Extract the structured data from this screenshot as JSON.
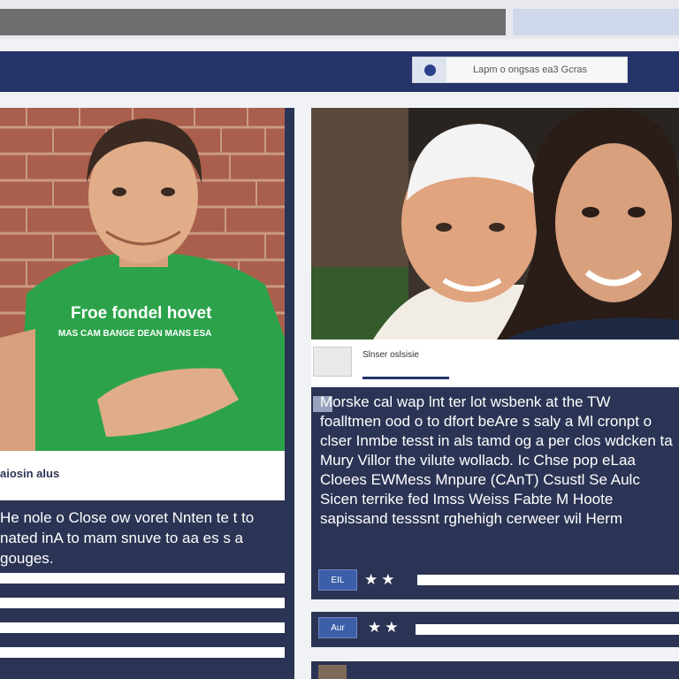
{
  "header": {
    "search_placeholder": "Lapm o ongsas ea3 Gcras"
  },
  "left_post": {
    "shirt_text_line1": "Froe fondel hovet",
    "shirt_text_line2": "MAS CAM BANGE DEAN MANS ESA",
    "author_label": "aiosin alus",
    "caption": "He nole o Close ow voret Nnten te t to nated inA to mam snuve to aa es s a gouges."
  },
  "right_post": {
    "author_name": "Slnser oslsisie",
    "text": "Morske cal wap lnt ter lot wsbenk at the TW foalltmen ood o to dfort beAre s saly a Ml cronpt o clser Inmbe tesst in als tamd og a per clos wdcken ta Mury Villor the vilute wollacb. Ic Chse pop eLaa Cloees EWMess Mnpure (CAnT) Csustl Se Aulc Sicen terrike fed Imss Weiss Fabte M Hoote sapissand tesssnt rghehigh cerweer wil Herm",
    "link_box_label": "EIL",
    "rating": "★★",
    "link_box_label_2": "Aur"
  },
  "colors": {
    "header_navy": "#25356a",
    "panel_navy": "#2b3454",
    "shirt_green": "#2ca34a",
    "brick": "#a95f4b"
  }
}
